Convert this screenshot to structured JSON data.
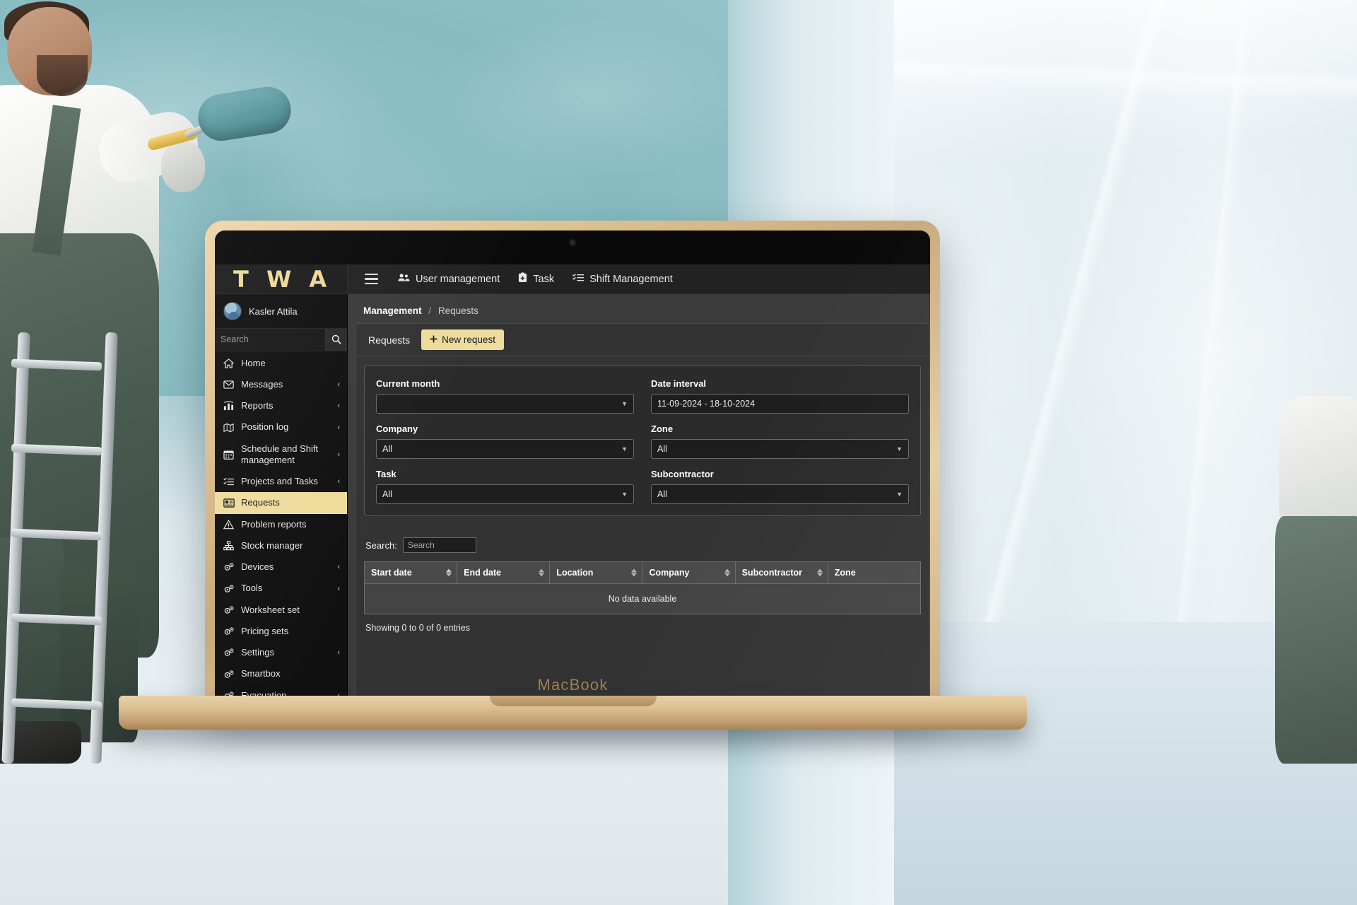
{
  "scene": {
    "device_label": "MacBook"
  },
  "app": {
    "brand": "T W A",
    "topnav": [
      {
        "label": "User management",
        "icon": "users-icon"
      },
      {
        "label": "Task",
        "icon": "clipboard-icon"
      },
      {
        "label": "Shift Management",
        "icon": "list-check-icon"
      }
    ],
    "menu_toggle_icon": "hamburger-icon"
  },
  "sidebar": {
    "user_name": "Kasler Attila",
    "search_placeholder": "Search",
    "search_icon": "magnifier-icon",
    "items": [
      {
        "label": "Home",
        "icon": "home-icon",
        "chevron": "",
        "active": false
      },
      {
        "label": "Messages",
        "icon": "envelope-icon",
        "chevron": "‹",
        "active": false
      },
      {
        "label": "Reports",
        "icon": "bar-chart-icon",
        "chevron": "‹",
        "active": false
      },
      {
        "label": "Position log",
        "icon": "map-icon",
        "chevron": "‹",
        "active": false
      },
      {
        "label": "Schedule and Shift management",
        "icon": "calendar-icon",
        "chevron": "‹",
        "active": false
      },
      {
        "label": "Projects and Tasks",
        "icon": "task-list-icon",
        "chevron": "‹",
        "active": false
      },
      {
        "label": "Requests",
        "icon": "request-card-icon",
        "chevron": "",
        "active": true
      },
      {
        "label": "Problem reports",
        "icon": "warning-triangle-icon",
        "chevron": "",
        "active": false
      },
      {
        "label": "Stock manager",
        "icon": "sitemap-icon",
        "chevron": "",
        "active": false
      },
      {
        "label": "Devices",
        "icon": "gears-icon",
        "chevron": "‹",
        "active": false
      },
      {
        "label": "Tools",
        "icon": "gears-icon",
        "chevron": "‹",
        "active": false
      },
      {
        "label": "Worksheet set",
        "icon": "gears-icon",
        "chevron": "",
        "active": false
      },
      {
        "label": "Pricing sets",
        "icon": "gears-icon",
        "chevron": "",
        "active": false
      },
      {
        "label": "Settings",
        "icon": "gears-icon",
        "chevron": "‹",
        "active": false
      },
      {
        "label": "Smartbox",
        "icon": "gears-icon",
        "chevron": "",
        "active": false
      },
      {
        "label": "Evacuation",
        "icon": "gears-icon",
        "chevron": "‹",
        "active": false
      }
    ]
  },
  "breadcrumb": {
    "root": "Management",
    "separator": "/",
    "current": "Requests"
  },
  "panel": {
    "tab_label": "Requests",
    "new_button": "New request",
    "new_button_icon": "plus-icon"
  },
  "filters": {
    "current_month": {
      "label": "Current month",
      "value": ""
    },
    "date_interval": {
      "label": "Date interval",
      "value": "11-09-2024 - 18-10-2024"
    },
    "company": {
      "label": "Company",
      "value": "All"
    },
    "zone": {
      "label": "Zone",
      "value": "All"
    },
    "task": {
      "label": "Task",
      "value": "All"
    },
    "subcontractor": {
      "label": "Subcontractor",
      "value": "All"
    }
  },
  "table": {
    "search_label": "Search:",
    "search_placeholder": "Search",
    "search_value": "",
    "columns": [
      {
        "label": "Start date",
        "sorted": true
      },
      {
        "label": "End date",
        "sorted": false
      },
      {
        "label": "Location",
        "sorted": false
      },
      {
        "label": "Company",
        "sorted": false
      },
      {
        "label": "Subcontractor",
        "sorted": false
      },
      {
        "label": "Zone",
        "sorted": false
      }
    ],
    "empty_message": "No data available",
    "footer": "Showing 0 to 0 of 0 entries"
  },
  "colors": {
    "accent": "#eedc9c",
    "sidebar_bg": "#111111",
    "content_bg": "#3b3b3b",
    "panel_bg": "#333333"
  }
}
